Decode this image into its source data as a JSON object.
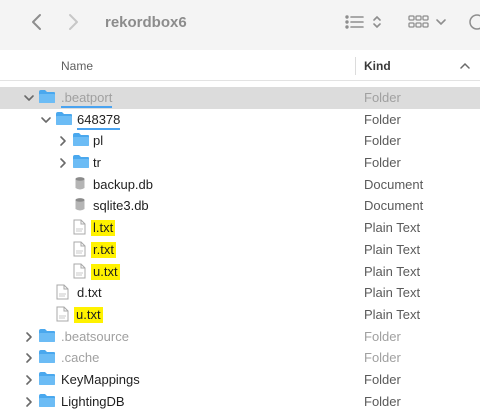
{
  "toolbar": {
    "title": "rekordbox6",
    "back_icon": "chevron-left-icon",
    "forward_icon": "chevron-right-icon",
    "list_view_icon": "list-view-icon",
    "grid_view_icon": "grid-view-icon"
  },
  "columns": {
    "name": "Name",
    "kind": "Kind"
  },
  "colors": {
    "folder": "#4aa8ee",
    "highlight": "#fff200",
    "selection": "#dcdcdc"
  },
  "rows": [
    {
      "name": ".beatport",
      "kind": "Folder"
    },
    {
      "name": "648378",
      "kind": "Folder"
    },
    {
      "name": "pl",
      "kind": "Folder"
    },
    {
      "name": "tr",
      "kind": "Folder"
    },
    {
      "name": "backup.db",
      "kind": "Document"
    },
    {
      "name": "sqlite3.db",
      "kind": "Document"
    },
    {
      "name": "l.txt",
      "kind": "Plain Text"
    },
    {
      "name": "r.txt",
      "kind": "Plain Text"
    },
    {
      "name": "u.txt",
      "kind": "Plain Text"
    },
    {
      "name": "d.txt",
      "kind": "Plain Text"
    },
    {
      "name": "u.txt",
      "kind": "Plain Text"
    },
    {
      "name": ".beatsource",
      "kind": "Folder"
    },
    {
      "name": ".cache",
      "kind": "Folder"
    },
    {
      "name": "KeyMappings",
      "kind": "Folder"
    },
    {
      "name": "LightingDB",
      "kind": "Folder"
    }
  ]
}
